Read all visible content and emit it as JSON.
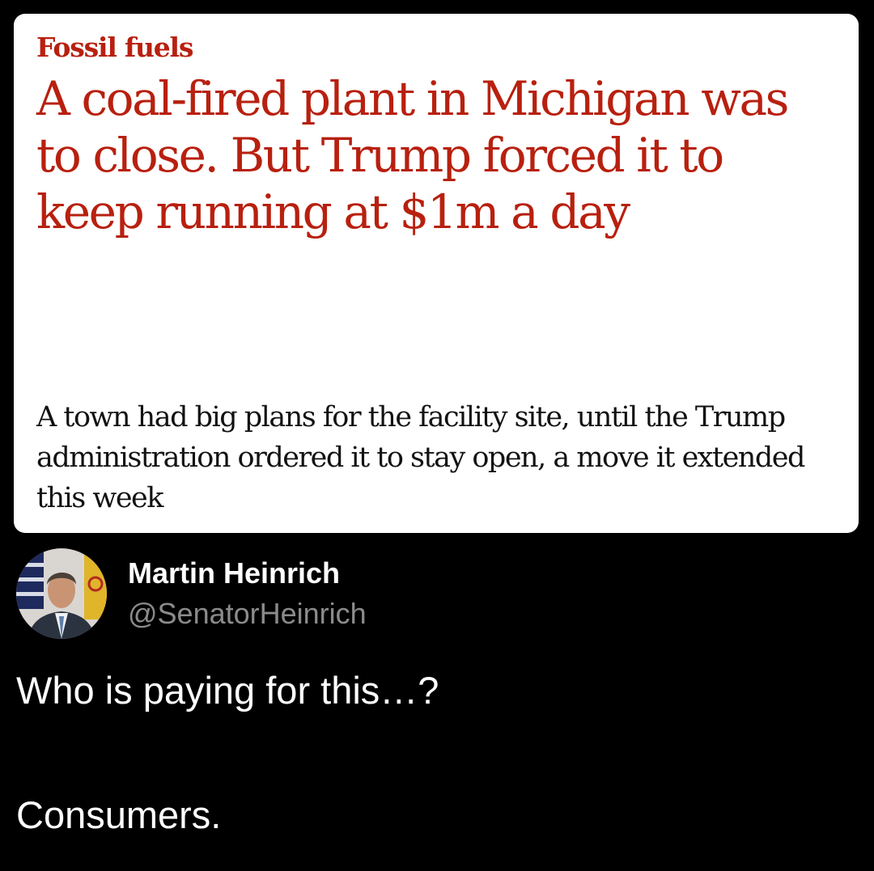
{
  "article": {
    "kicker": "Fossil fuels",
    "headline": "A coal-fired plant in Michigan was to close. But Trump forced it to keep running at $1m a day",
    "standfirst": "A town had big plans for the facility site, until the Trump administration ordered it to stay open, a move it extended this week"
  },
  "author": {
    "name": "Martin Heinrich",
    "handle": "@SenatorHeinrich",
    "avatar_icon": "profile-photo"
  },
  "post": {
    "lines": [
      "Who is paying for this…?",
      "Consumers."
    ]
  },
  "colors": {
    "background": "#000000",
    "card": "#ffffff",
    "headline_red": "#b8200f",
    "body_text": "#121212",
    "handle_gray": "#8b8b8b"
  }
}
